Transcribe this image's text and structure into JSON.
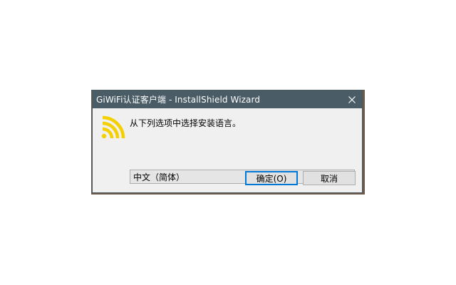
{
  "window": {
    "title": "GiWiFi认证客户端 - InstallShield Wizard",
    "close_icon": "close-icon"
  },
  "dialog": {
    "app_icon": "wifi-signal-icon",
    "prompt": "从下列选项中选择安装语言。",
    "language_select": {
      "selected": "中文（简体）",
      "arrow_icon": "chevron-down-icon"
    },
    "ok_label": "确定(O)",
    "cancel_label": "取消"
  },
  "colors": {
    "titlebar": "#4a5c66",
    "dialog_bg": "#f0f0f0",
    "icon_yellow": "#f5d000",
    "focus_border": "#0078d7"
  }
}
